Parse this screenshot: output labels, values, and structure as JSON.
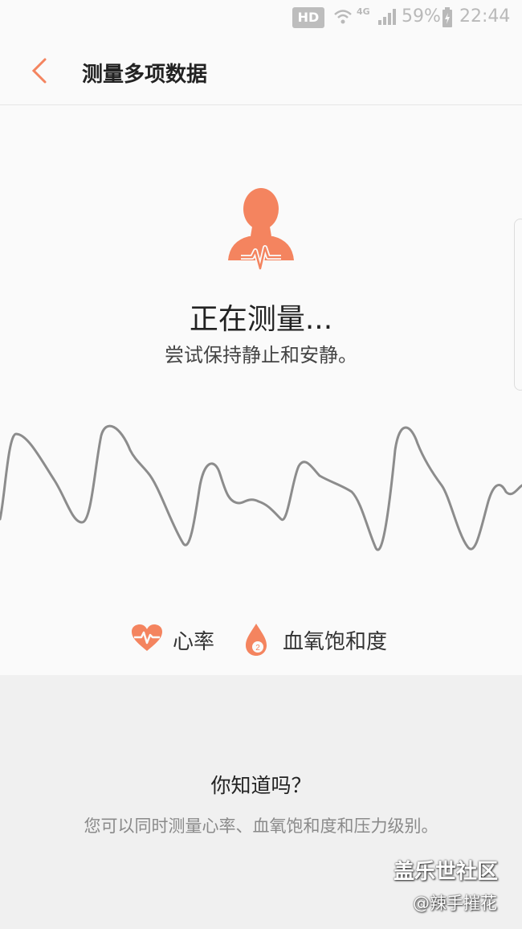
{
  "status_bar": {
    "hd": "HD",
    "network": "4G",
    "battery": "59%",
    "time": "22:44",
    "icons": [
      "wifi-icon",
      "signal-icon",
      "battery-charging-icon"
    ]
  },
  "header": {
    "title": "测量多项数据",
    "back_icon": "chevron-left-icon"
  },
  "measurement": {
    "icon": "person-heartbeat-icon",
    "status": "正在测量...",
    "instruction": "尝试保持静止和安静。"
  },
  "metrics": [
    {
      "icon": "heart-pulse-icon",
      "label": "心率"
    },
    {
      "icon": "oxygen-drop-icon",
      "label": "血氧饱和度",
      "badge": "2"
    }
  ],
  "tip": {
    "title": "你知道吗？",
    "body": "您可以同时测量心率、血氧饱和度和压力级别。"
  },
  "watermark": {
    "site": "盖乐世社区",
    "author": "@辣手摧花"
  },
  "colors": {
    "accent": "#f4845f",
    "waveform": "#8c8c8c",
    "panel": "#f0f0f0"
  }
}
